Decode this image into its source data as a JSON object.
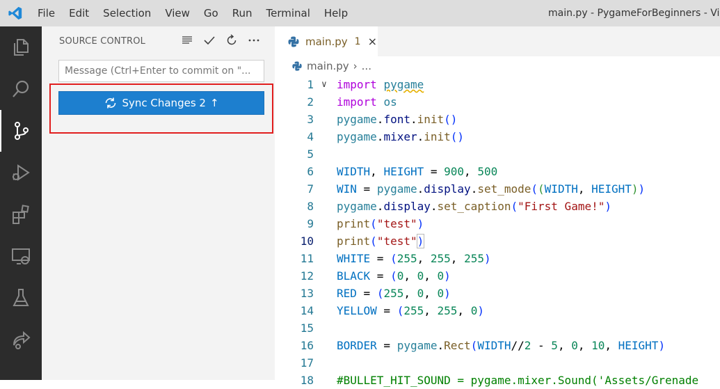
{
  "menu": [
    "File",
    "Edit",
    "Selection",
    "View",
    "Go",
    "Run",
    "Terminal",
    "Help"
  ],
  "window_title": "main.py - PygameForBeginners - Visu",
  "activity_bar": [
    "explorer-icon",
    "search-icon",
    "source-control-icon",
    "run-debug-icon",
    "extensions-icon",
    "remote-explorer-icon",
    "testing-icon",
    "live-share-icon"
  ],
  "sidebar": {
    "header": "SOURCE CONTROL",
    "message_placeholder": "Message (Ctrl+Enter to commit on \"...",
    "sync_button": {
      "label": "Sync Changes 2",
      "arrow": "↑"
    }
  },
  "tab": {
    "label": "main.py",
    "modified_count": "1",
    "close": "×"
  },
  "breadcrumb": {
    "file": "main.py",
    "sep": "›",
    "rest": "..."
  },
  "colors": {
    "accent": "#1d7fcf",
    "highlight_box": "#e11e1e",
    "activity_bg": "#2c2c2c"
  },
  "code_lines": [
    {
      "n": "1",
      "t": "import pygame"
    },
    {
      "n": "2",
      "t": "import os"
    },
    {
      "n": "3",
      "t": "pygame.font.init()"
    },
    {
      "n": "4",
      "t": "pygame.mixer.init()"
    },
    {
      "n": "5",
      "t": ""
    },
    {
      "n": "6",
      "t": "WIDTH, HEIGHT = 900, 500"
    },
    {
      "n": "7",
      "t": "WIN = pygame.display.set_mode((WIDTH, HEIGHT))"
    },
    {
      "n": "8",
      "t": "pygame.display.set_caption(\"First Game!\")"
    },
    {
      "n": "9",
      "t": "print(\"test\")"
    },
    {
      "n": "10",
      "t": "print(\"test\")"
    },
    {
      "n": "11",
      "t": "WHITE = (255, 255, 255)"
    },
    {
      "n": "12",
      "t": "BLACK = (0, 0, 0)"
    },
    {
      "n": "13",
      "t": "RED = (255, 0, 0)"
    },
    {
      "n": "14",
      "t": "YELLOW = (255, 255, 0)"
    },
    {
      "n": "15",
      "t": ""
    },
    {
      "n": "16",
      "t": "BORDER = pygame.Rect(WIDTH//2 - 5, 0, 10, HEIGHT)"
    },
    {
      "n": "17",
      "t": ""
    },
    {
      "n": "18",
      "t": "#BULLET_HIT_SOUND = pygame.mixer.Sound('Assets/Grenade"
    }
  ]
}
